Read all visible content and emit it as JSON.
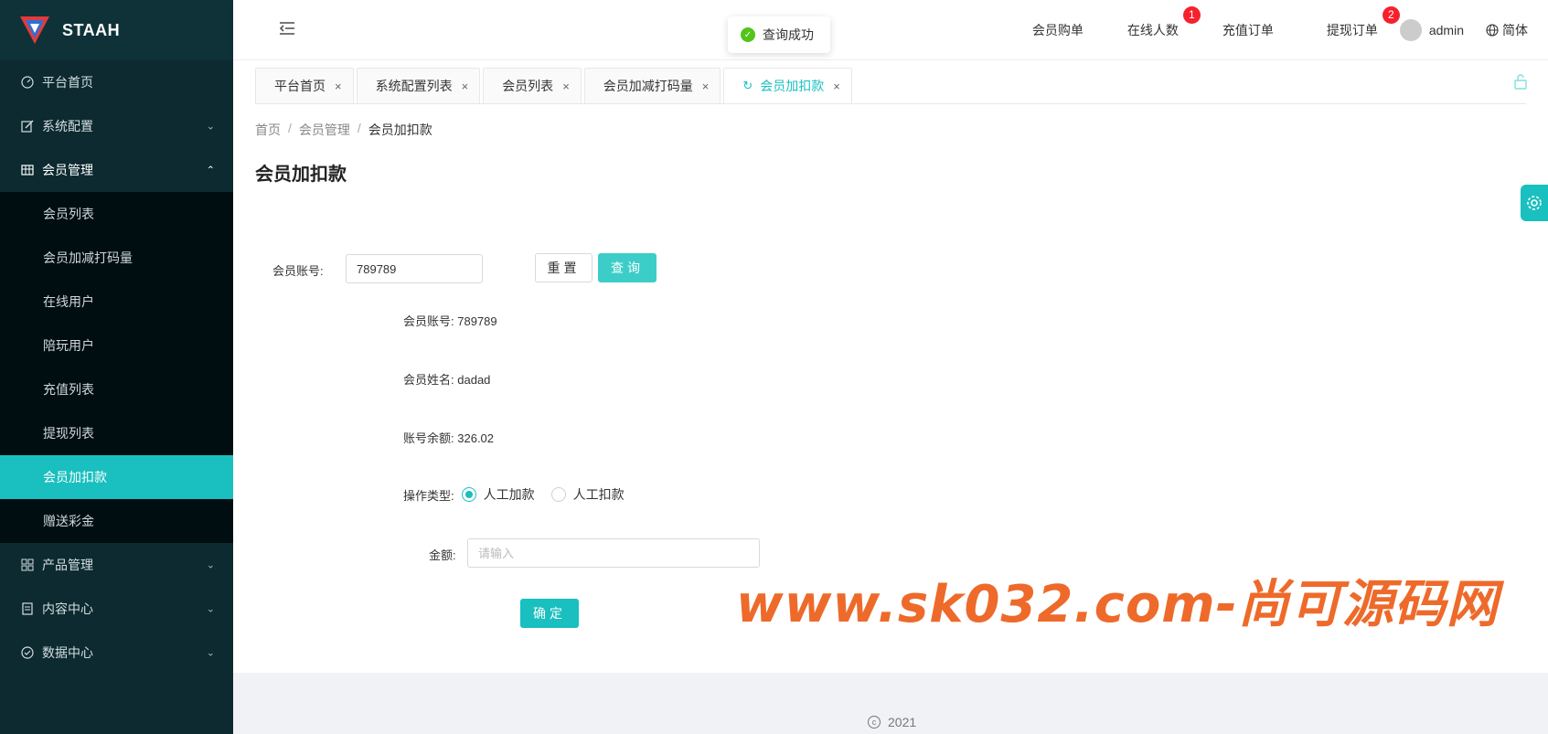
{
  "app": {
    "name": "STAAH"
  },
  "toast": {
    "message": "查询成功"
  },
  "sidebar": {
    "items": [
      {
        "label": "平台首页",
        "icon": "dashboard-icon"
      },
      {
        "label": "系统配置",
        "icon": "edit-icon"
      },
      {
        "label": "会员管理",
        "icon": "table-icon"
      },
      {
        "label": "产品管理",
        "icon": "grid-icon"
      },
      {
        "label": "内容中心",
        "icon": "document-icon"
      },
      {
        "label": "数据中心",
        "icon": "check-circle-icon"
      }
    ],
    "member_submenu": [
      {
        "label": "会员列表"
      },
      {
        "label": "会员加减打码量"
      },
      {
        "label": "在线用户"
      },
      {
        "label": "陪玩用户"
      },
      {
        "label": "充值列表"
      },
      {
        "label": "提现列表"
      },
      {
        "label": "会员加扣款"
      },
      {
        "label": "赠送彩金"
      }
    ]
  },
  "header": {
    "links": [
      {
        "label": "会员购单",
        "badge": null
      },
      {
        "label": "在线人数",
        "badge": "1"
      },
      {
        "label": "充值订单",
        "badge": null
      },
      {
        "label": "提现订单",
        "badge": "2"
      }
    ],
    "username": "admin",
    "language": "简体"
  },
  "tabs": [
    {
      "label": "平台首页"
    },
    {
      "label": "系统配置列表"
    },
    {
      "label": "会员列表"
    },
    {
      "label": "会员加减打码量"
    },
    {
      "label": "会员加扣款"
    }
  ],
  "tab_close": "×",
  "breadcrumb": {
    "home": "首页",
    "section": "会员管理",
    "current": "会员加扣款",
    "sep": "/"
  },
  "page_title": "会员加扣款",
  "search": {
    "label": "会员账号:",
    "value": "789789",
    "reset_label": "重置",
    "query_label": "查询"
  },
  "member": {
    "account_label": "会员账号:",
    "account_value": "789789",
    "name_label": "会员姓名:",
    "name_value": "dadad",
    "balance_label": "账号余额:",
    "balance_value": "326.02",
    "op_type_label": "操作类型:",
    "op_options": [
      {
        "label": "人工加款",
        "checked": true
      },
      {
        "label": "人工扣款",
        "checked": false
      }
    ],
    "amount_label": "金额:",
    "amount_placeholder": "请输入",
    "confirm_label": "确定"
  },
  "watermark": "www.sk032.com-尚可源码网",
  "footer": {
    "year": "2021"
  },
  "colors": {
    "accent": "#1abfbf",
    "sidebar_bg": "#0c2a30",
    "badge": "#f5222d",
    "watermark": "#ee6a2a"
  }
}
